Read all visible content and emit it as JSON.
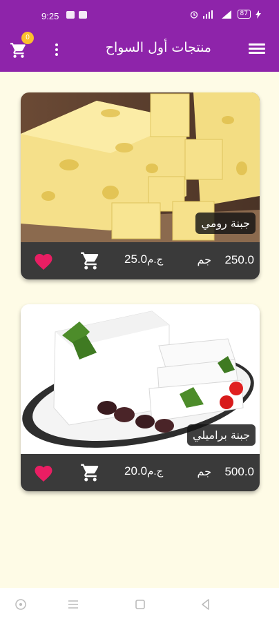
{
  "status_bar": {
    "time": "9:25",
    "battery": "87"
  },
  "app_bar": {
    "title": "منتجات أول السواح",
    "cart_count": "0"
  },
  "products": [
    {
      "name": "جبنة رومي",
      "weight": "250.0",
      "weight_unit": "جم",
      "price": "25.0",
      "currency": "ج.م",
      "image_icon": "cheese-cubes-image"
    },
    {
      "name": "جبنة براميلي",
      "weight": "500.0",
      "weight_unit": "جم",
      "price": "20.0",
      "currency": "ج.م",
      "image_icon": "white-cheese-plate-image"
    }
  ],
  "colors": {
    "primary": "#8e24aa",
    "background": "#fefbe6",
    "favorite": "#e91e63",
    "footer": "#3a3a3a",
    "badge": "#fbc02d"
  }
}
